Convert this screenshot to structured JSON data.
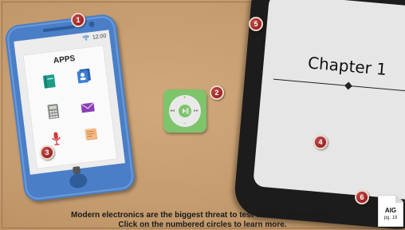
{
  "phone": {
    "status_time": "12:00",
    "apps_title": "APPS",
    "apps": [
      "book-icon",
      "contacts-icon",
      "calculator-icon",
      "mail-icon",
      "microphone-icon",
      "notes-icon"
    ]
  },
  "tablet": {
    "chapter_title": "Chapter 1"
  },
  "hotspots": [
    "1",
    "2",
    "3",
    "4",
    "5",
    "6"
  ],
  "caption": {
    "line1": "Modern electronics are the biggest threat to test validity and security.",
    "line2": "Click on the numbered circles to learn more."
  },
  "badge": {
    "title": "AIG",
    "page": "pg. 18"
  },
  "colors": {
    "background": "#c79e71",
    "phone": "#4a7fc7",
    "ipod": "#7dc46b",
    "tablet": "#1c1c1c",
    "hotspot": "#9a2424"
  }
}
